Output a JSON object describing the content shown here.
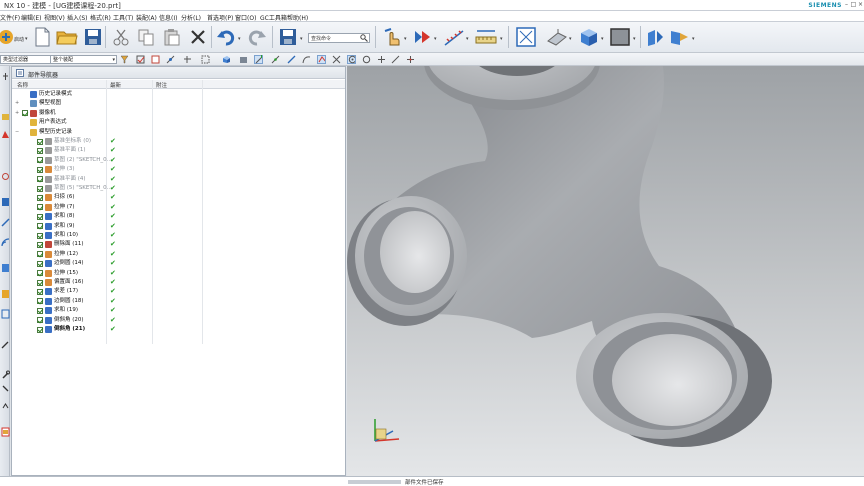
{
  "window": {
    "title": "NX 10 - 建模 - [UG建模课程-20.prt]",
    "brand": "SIEMENS"
  },
  "menubar": {
    "items": [
      "文件(F)",
      "编辑(E)",
      "视图(V)",
      "插入(S)",
      "格式(R)",
      "工具(T)",
      "装配(A)",
      "信息(I)",
      "分析(L)",
      "首选项(P)",
      "窗口(O)",
      "GC工具箱",
      "帮助(H)"
    ]
  },
  "toolbar": {
    "start_label": "启动",
    "command_search_placeholder": "查找命令"
  },
  "selection_bar": {
    "filter_value": "类型过滤器",
    "scope_value": "整个装配"
  },
  "navigator": {
    "title": "部件导航器",
    "columns": {
      "name": "名称",
      "latest": "最新",
      "note": "附注"
    },
    "rows": [
      {
        "label": "历史记录模式",
        "level": 0,
        "expander": "",
        "checkbox": false,
        "dim": false,
        "bold": false,
        "latest": "",
        "icon": "history-icon",
        "icon_color": "#3a6fc4"
      },
      {
        "label": "模型视图",
        "level": 0,
        "expander": "+",
        "checkbox": false,
        "dim": false,
        "bold": false,
        "latest": "",
        "icon": "model-views-icon",
        "icon_color": "#5f8fbf"
      },
      {
        "label": "摄像机",
        "level": 0,
        "expander": "+",
        "checkbox": true,
        "dim": false,
        "bold": false,
        "latest": "",
        "icon": "camera-icon",
        "icon_color": "#c0463a"
      },
      {
        "label": "用户表达式",
        "level": 0,
        "expander": "",
        "checkbox": false,
        "dim": false,
        "bold": false,
        "latest": "",
        "icon": "folder-icon",
        "icon_color": "#e0b43c"
      },
      {
        "label": "模型历史记录",
        "level": 0,
        "expander": "−",
        "checkbox": false,
        "dim": false,
        "bold": false,
        "latest": "",
        "icon": "folder-icon",
        "icon_color": "#e0b43c"
      },
      {
        "label": "基准坐标系 (0)",
        "level": 1,
        "expander": "",
        "checkbox": true,
        "dim": true,
        "bold": false,
        "latest": "✔",
        "icon": "datum-csys-icon",
        "icon_color": "#9a9a9a"
      },
      {
        "label": "基准平面 (1)",
        "level": 1,
        "expander": "",
        "checkbox": true,
        "dim": true,
        "bold": false,
        "latest": "✔",
        "icon": "datum-plane-icon",
        "icon_color": "#9a9a9a"
      },
      {
        "label": "草图 (2) \"SKETCH_0...",
        "level": 1,
        "expander": "",
        "checkbox": true,
        "dim": true,
        "bold": false,
        "latest": "✔",
        "icon": "sketch-icon",
        "icon_color": "#9a9a9a"
      },
      {
        "label": "拉伸 (3)",
        "level": 1,
        "expander": "",
        "checkbox": true,
        "dim": true,
        "bold": false,
        "latest": "✔",
        "icon": "extrude-icon",
        "icon_color": "#d98a3a"
      },
      {
        "label": "基准平面 (4)",
        "level": 1,
        "expander": "",
        "checkbox": true,
        "dim": true,
        "bold": false,
        "latest": "✔",
        "icon": "datum-plane-icon",
        "icon_color": "#9a9a9a"
      },
      {
        "label": "草图 (5) \"SKETCH_0...",
        "level": 1,
        "expander": "",
        "checkbox": true,
        "dim": true,
        "bold": false,
        "latest": "✔",
        "icon": "sketch-icon",
        "icon_color": "#9a9a9a"
      },
      {
        "label": "扫掠 (6)",
        "level": 1,
        "expander": "",
        "checkbox": true,
        "dim": false,
        "bold": false,
        "latest": "✔",
        "icon": "sweep-icon",
        "icon_color": "#d98a3a"
      },
      {
        "label": "拉伸 (7)",
        "level": 1,
        "expander": "",
        "checkbox": true,
        "dim": false,
        "bold": false,
        "latest": "✔",
        "icon": "extrude-icon",
        "icon_color": "#d98a3a"
      },
      {
        "label": "求和 (8)",
        "level": 1,
        "expander": "",
        "checkbox": true,
        "dim": false,
        "bold": false,
        "latest": "✔",
        "icon": "unite-icon",
        "icon_color": "#3a6fc4"
      },
      {
        "label": "求和 (9)",
        "level": 1,
        "expander": "",
        "checkbox": true,
        "dim": false,
        "bold": false,
        "latest": "✔",
        "icon": "unite-icon",
        "icon_color": "#3a6fc4"
      },
      {
        "label": "求和 (10)",
        "level": 1,
        "expander": "",
        "checkbox": true,
        "dim": false,
        "bold": false,
        "latest": "✔",
        "icon": "unite-icon",
        "icon_color": "#3a6fc4"
      },
      {
        "label": "删除面 (11)",
        "level": 1,
        "expander": "",
        "checkbox": true,
        "dim": false,
        "bold": false,
        "latest": "✔",
        "icon": "delete-face-icon",
        "icon_color": "#c0463a"
      },
      {
        "label": "拉伸 (12)",
        "level": 1,
        "expander": "",
        "checkbox": true,
        "dim": false,
        "bold": false,
        "latest": "✔",
        "icon": "extrude-icon",
        "icon_color": "#d98a3a"
      },
      {
        "label": "边倒圆 (14)",
        "level": 1,
        "expander": "",
        "checkbox": true,
        "dim": false,
        "bold": false,
        "latest": "✔",
        "icon": "edge-blend-icon",
        "icon_color": "#3a6fc4"
      },
      {
        "label": "拉伸 (15)",
        "level": 1,
        "expander": "",
        "checkbox": true,
        "dim": false,
        "bold": false,
        "latest": "✔",
        "icon": "extrude-icon",
        "icon_color": "#d98a3a"
      },
      {
        "label": "偏置面 (16)",
        "level": 1,
        "expander": "",
        "checkbox": true,
        "dim": false,
        "bold": false,
        "latest": "✔",
        "icon": "offset-face-icon",
        "icon_color": "#d98a3a"
      },
      {
        "label": "求差 (17)",
        "level": 1,
        "expander": "",
        "checkbox": true,
        "dim": false,
        "bold": false,
        "latest": "✔",
        "icon": "subtract-icon",
        "icon_color": "#3a6fc4"
      },
      {
        "label": "边倒圆 (18)",
        "level": 1,
        "expander": "",
        "checkbox": true,
        "dim": false,
        "bold": false,
        "latest": "✔",
        "icon": "edge-blend-icon",
        "icon_color": "#3a6fc4"
      },
      {
        "label": "求和 (19)",
        "level": 1,
        "expander": "",
        "checkbox": true,
        "dim": false,
        "bold": false,
        "latest": "✔",
        "icon": "unite-icon",
        "icon_color": "#3a6fc4"
      },
      {
        "label": "倒斜角 (20)",
        "level": 1,
        "expander": "",
        "checkbox": true,
        "dim": false,
        "bold": false,
        "latest": "✔",
        "icon": "chamfer-icon",
        "icon_color": "#3a6fc4"
      },
      {
        "label": "倒斜角 (21)",
        "level": 1,
        "expander": "",
        "checkbox": true,
        "dim": false,
        "bold": true,
        "latest": "✔",
        "icon": "chamfer-icon",
        "icon_color": "#3a6fc4"
      }
    ]
  },
  "status": {
    "message": "部件文件已保存"
  }
}
